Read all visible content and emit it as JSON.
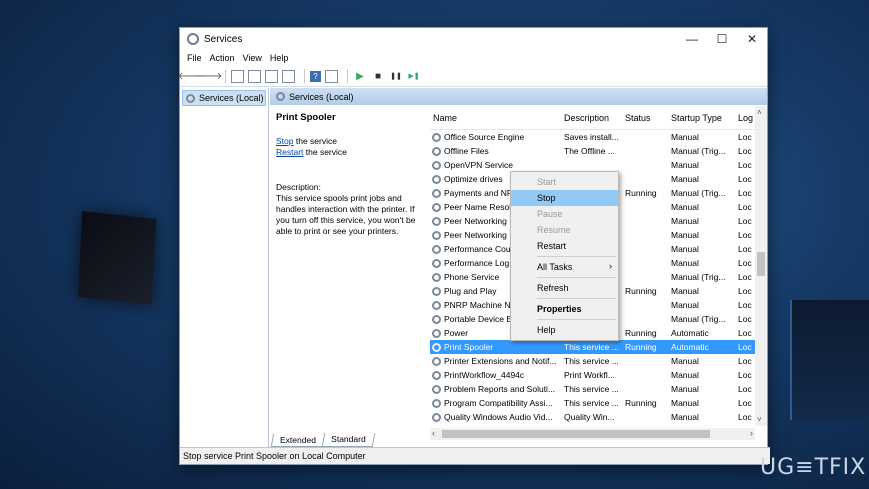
{
  "window": {
    "title": "Services",
    "minimize": "—",
    "maximize": "☐",
    "close": "✕"
  },
  "menu": [
    "File",
    "Action",
    "View",
    "Help"
  ],
  "toolbar": {
    "back": "🡐",
    "forward": "🡒",
    "play": "▶",
    "stop": "■",
    "pause": "❚❚",
    "restart": "▶❚",
    "help": "?"
  },
  "tree": {
    "root": "Services (Local)"
  },
  "panel": {
    "header": "Services (Local)",
    "service_name": "Print Spooler",
    "stop_link": "Stop",
    "stop_suffix": " the service",
    "restart_link": "Restart",
    "restart_suffix": " the service",
    "description_label": "Description:",
    "description_text": "This service spools print jobs and handles interaction with the printer. If you turn off this service, you won't be able to print or see your printers."
  },
  "columns": [
    "Name",
    "Description",
    "Status",
    "Startup Type",
    "Log"
  ],
  "rows": [
    [
      "Office Source Engine",
      "Saves install...",
      "",
      "Manual",
      "Loc"
    ],
    [
      "Offline Files",
      "The Offline ...",
      "",
      "Manual (Trig...",
      "Loc"
    ],
    [
      "OpenVPN Service",
      "",
      "",
      "Manual",
      "Loc"
    ],
    [
      "Optimize drives",
      "",
      "",
      "Manual",
      "Loc"
    ],
    [
      "Payments and NF",
      "",
      "Running",
      "Manual (Trig...",
      "Loc"
    ],
    [
      "Peer Name Resolu",
      "",
      "",
      "Manual",
      "Loc"
    ],
    [
      "Peer Networking",
      "",
      "",
      "Manual",
      "Loc"
    ],
    [
      "Peer Networking",
      "",
      "",
      "Manual",
      "Loc"
    ],
    [
      "Performance Cou",
      "",
      "",
      "Manual",
      "Loc"
    ],
    [
      "Performance Log",
      "",
      "",
      "Manual",
      "Loc"
    ],
    [
      "Phone Service",
      "",
      "",
      "Manual (Trig...",
      "Loc"
    ],
    [
      "Plug and Play",
      "",
      "Running",
      "Manual",
      "Loc"
    ],
    [
      "PNRP Machine N",
      "",
      "",
      "Manual",
      "Loc"
    ],
    [
      "Portable Device E",
      "",
      "",
      "Manual (Trig...",
      "Loc"
    ],
    [
      "Power",
      "",
      "Running",
      "Automatic",
      "Loc"
    ],
    [
      "Print Spooler",
      "This service ...",
      "Running",
      "Automatic",
      "Loc"
    ],
    [
      "Printer Extensions and Notif...",
      "This service ...",
      "",
      "Manual",
      "Loc"
    ],
    [
      "PrintWorkflow_4494c",
      "Print Workfl...",
      "",
      "Manual",
      "Loc"
    ],
    [
      "Problem Reports and Soluti...",
      "This service ...",
      "",
      "Manual",
      "Loc"
    ],
    [
      "Program Compatibility Assi...",
      "This service ...",
      "Running",
      "Manual",
      "Loc"
    ],
    [
      "Quality Windows Audio Vid...",
      "Quality Win...",
      "",
      "Manual",
      "Loc"
    ]
  ],
  "selected_row": 15,
  "context_menu": {
    "start": "Start",
    "stop": "Stop",
    "pause": "Pause",
    "resume": "Resume",
    "restart": "Restart",
    "all_tasks": "All Tasks",
    "refresh": "Refresh",
    "properties": "Properties",
    "help": "Help"
  },
  "tabs": [
    "Extended",
    "Standard"
  ],
  "status_bar": "Stop service Print Spooler on Local Computer",
  "watermark": "UG≡TFIX",
  "colors": {
    "selection": "#3399ff",
    "menu_highlight": "#91c9f7",
    "header": "#b2cce8"
  }
}
